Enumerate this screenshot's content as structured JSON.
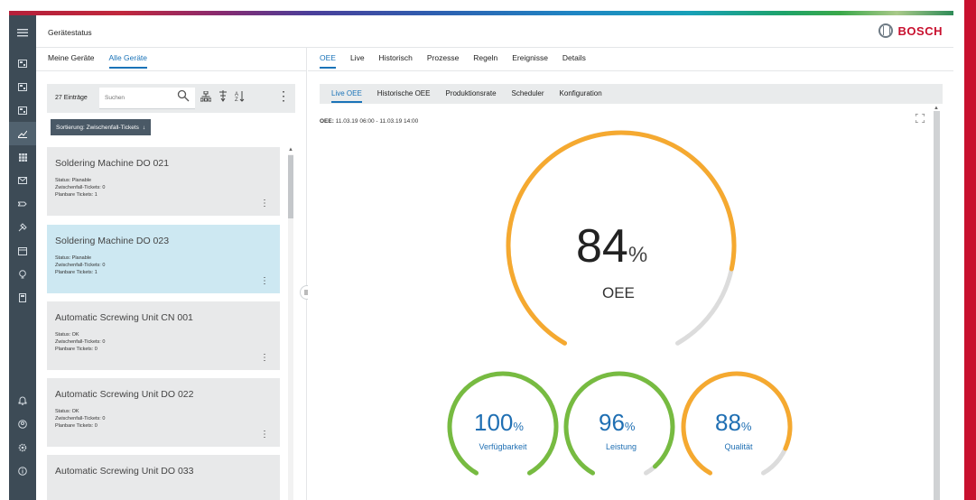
{
  "header": {
    "title": "Gerätestatus",
    "brand": "BOSCH"
  },
  "nav": {
    "icons": [
      "menu-icon",
      "dashboard-icon",
      "dashboard-icon",
      "dashboard-icon",
      "chart-icon",
      "grid-icon",
      "mail-icon",
      "process-icon",
      "tools-icon",
      "calendar-icon",
      "bulb-icon",
      "calculator-icon",
      "bell-icon",
      "user-icon",
      "settings-icon",
      "info-icon"
    ]
  },
  "left": {
    "tabs": [
      "Meine Geräte",
      "Alle Geräte"
    ],
    "active_tab": "Alle Geräte",
    "count": "27 Einträge",
    "search_placeholder": "Suchen",
    "sort_label": "Sortierung: Zwischenfall-Tickets",
    "devices": [
      {
        "name": "Soldering Machine DO 021",
        "status": "Status: Planable",
        "incident": "Zwischenfall-Tickets: 0",
        "planned": "Planbare Tickets: 1"
      },
      {
        "name": "Soldering Machine DO 023",
        "status": "Status: Planable",
        "incident": "Zwischenfall-Tickets: 0",
        "planned": "Planbare Tickets: 1"
      },
      {
        "name": "Automatic Screwing Unit CN 001",
        "status": "Status: OK",
        "incident": "Zwischenfall-Tickets: 0",
        "planned": "Planbare Tickets: 0"
      },
      {
        "name": "Automatic Screwing Unit DO 022",
        "status": "Status: OK",
        "incident": "Zwischenfall-Tickets: 0",
        "planned": "Planbare Tickets: 0"
      },
      {
        "name": "Automatic Screwing Unit DO 033",
        "status": "",
        "incident": "",
        "planned": ""
      }
    ]
  },
  "right": {
    "tabs": [
      "OEE",
      "Live",
      "Historisch",
      "Prozesse",
      "Regeln",
      "Ereignisse",
      "Details"
    ],
    "active_tab": "OEE",
    "subtabs": [
      "Live OEE",
      "Historische OEE",
      "Produktionsrate",
      "Scheduler",
      "Konfiguration"
    ],
    "active_subtab": "Live OEE",
    "period_label": "OEE:",
    "period_value": "11.03.19 06:00 - 11.03.19 14:00",
    "oee": {
      "value": "84",
      "unit": "%",
      "label": "OEE",
      "fraction": 0.84,
      "color": "#f5a930"
    },
    "kpis": [
      {
        "value": "100",
        "unit": "%",
        "label": "Verfügbarkeit",
        "fraction": 1.0,
        "color": "#77bb41"
      },
      {
        "value": "96",
        "unit": "%",
        "label": "Leistung",
        "fraction": 0.96,
        "color": "#77bb41"
      },
      {
        "value": "88",
        "unit": "%",
        "label": "Qualität",
        "fraction": 0.88,
        "color": "#f5a930"
      }
    ]
  }
}
